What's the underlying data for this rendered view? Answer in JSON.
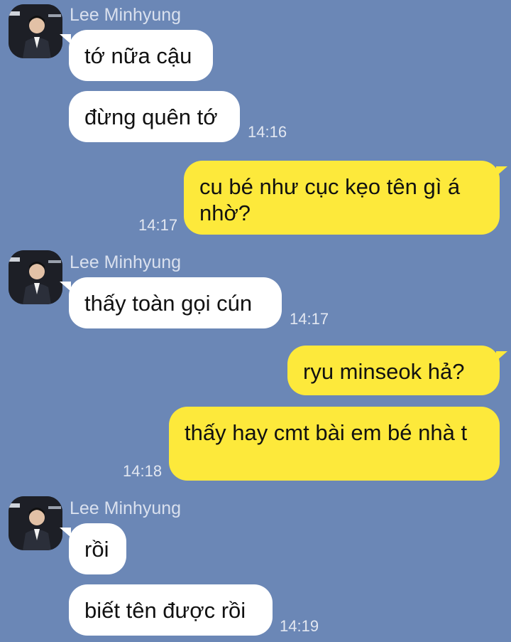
{
  "colors": {
    "background": "#6b87b6",
    "incoming": "#ffffff",
    "outgoing": "#fde93b"
  },
  "messages": [
    {
      "sender": "Lee Minhyung",
      "text": "tớ nữa cậu"
    },
    {
      "text": "đừng quên tớ",
      "time": "14:16"
    },
    {
      "text": "cu bé như cục kẹo tên gì á nhờ?",
      "time": "14:17"
    },
    {
      "sender": "Lee Minhyung",
      "text": "thấy toàn gọi cún",
      "time": "14:17"
    },
    {
      "text": "ryu minseok hả?"
    },
    {
      "text": "thấy hay cmt bài em bé nhà t",
      "time": "14:18"
    },
    {
      "sender": "Lee Minhyung",
      "text": "rồi"
    },
    {
      "text": "biết tên được rồi",
      "time": "14:19"
    }
  ]
}
